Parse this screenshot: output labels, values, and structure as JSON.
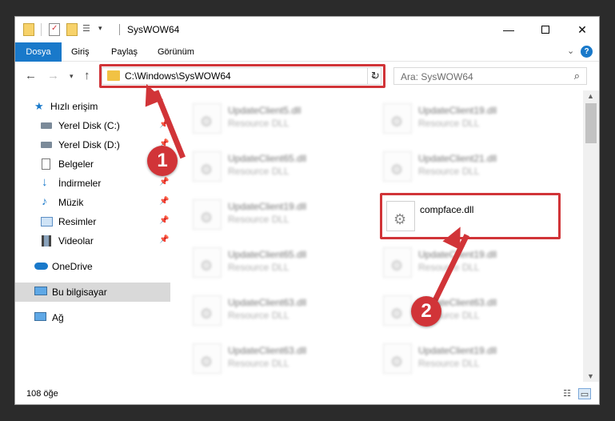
{
  "window": {
    "title": "SysWOW64"
  },
  "ribbon": {
    "tabs": [
      {
        "label": "Dosya",
        "active": true
      },
      {
        "label": "Giriş"
      },
      {
        "label": "Paylaş"
      },
      {
        "label": "Görünüm"
      }
    ],
    "expand_icon": "chevron-down-icon",
    "help_label": "?"
  },
  "address": {
    "path": "C:\\Windows\\SysWOW64",
    "search_placeholder": "Ara: SysWOW64"
  },
  "navpane": {
    "items": [
      {
        "label": "Hızlı erişim",
        "icon": "star-icon",
        "color": "#1979ca"
      },
      {
        "label": "Yerel Disk (C:)",
        "icon": "drive-icon",
        "pinned": true
      },
      {
        "label": "Yerel Disk (D:)",
        "icon": "drive-icon",
        "pinned": true
      },
      {
        "label": "Belgeler",
        "icon": "document-icon",
        "pinned": true
      },
      {
        "label": "İndirmeler",
        "icon": "download-icon",
        "pinned": true
      },
      {
        "label": "Müzik",
        "icon": "music-icon",
        "pinned": true
      },
      {
        "label": "Resimler",
        "icon": "pictures-icon",
        "pinned": true
      },
      {
        "label": "Videolar",
        "icon": "video-icon",
        "pinned": true
      },
      {
        "label": "OneDrive",
        "icon": "cloud-icon"
      },
      {
        "label": "Bu bilgisayar",
        "icon": "computer-icon",
        "selected": true
      },
      {
        "label": "Ağ",
        "icon": "network-icon"
      }
    ]
  },
  "files": [
    {
      "name": "UpdateClient5.dll",
      "type": "Resource DLL",
      "blurred": true
    },
    {
      "name": "UpdateClient19.dll",
      "type": "Resource DLL",
      "blurred": true
    },
    {
      "name": "UpdateClient65.dll",
      "type": "Resource DLL",
      "blurred": true
    },
    {
      "name": "UpdateClient21.dll",
      "type": "Resource DLL",
      "blurred": true
    },
    {
      "name": "UpdateClient19.dll",
      "type": "Resource DLL",
      "blurred": true
    },
    {
      "name": "compface.dll",
      "type": "",
      "blurred": false
    },
    {
      "name": "UpdateClient65.dll",
      "type": "Resource DLL",
      "blurred": true
    },
    {
      "name": "UpdateClient19.dll",
      "type": "Resource DLL",
      "blurred": true
    },
    {
      "name": "UpdateClient63.dll",
      "type": "Resource DLL",
      "blurred": true
    },
    {
      "name": "UpdateClient63.dll",
      "type": "Resource DLL",
      "blurred": true
    },
    {
      "name": "UpdateClient63.dll",
      "type": "Resource DLL",
      "blurred": true
    },
    {
      "name": "UpdateClient19.dll",
      "type": "Resource DLL",
      "blurred": true
    }
  ],
  "status": {
    "item_count": "108 öğe"
  },
  "annotations": {
    "step1": "1",
    "step2": "2",
    "highlight_color": "#d13438"
  }
}
